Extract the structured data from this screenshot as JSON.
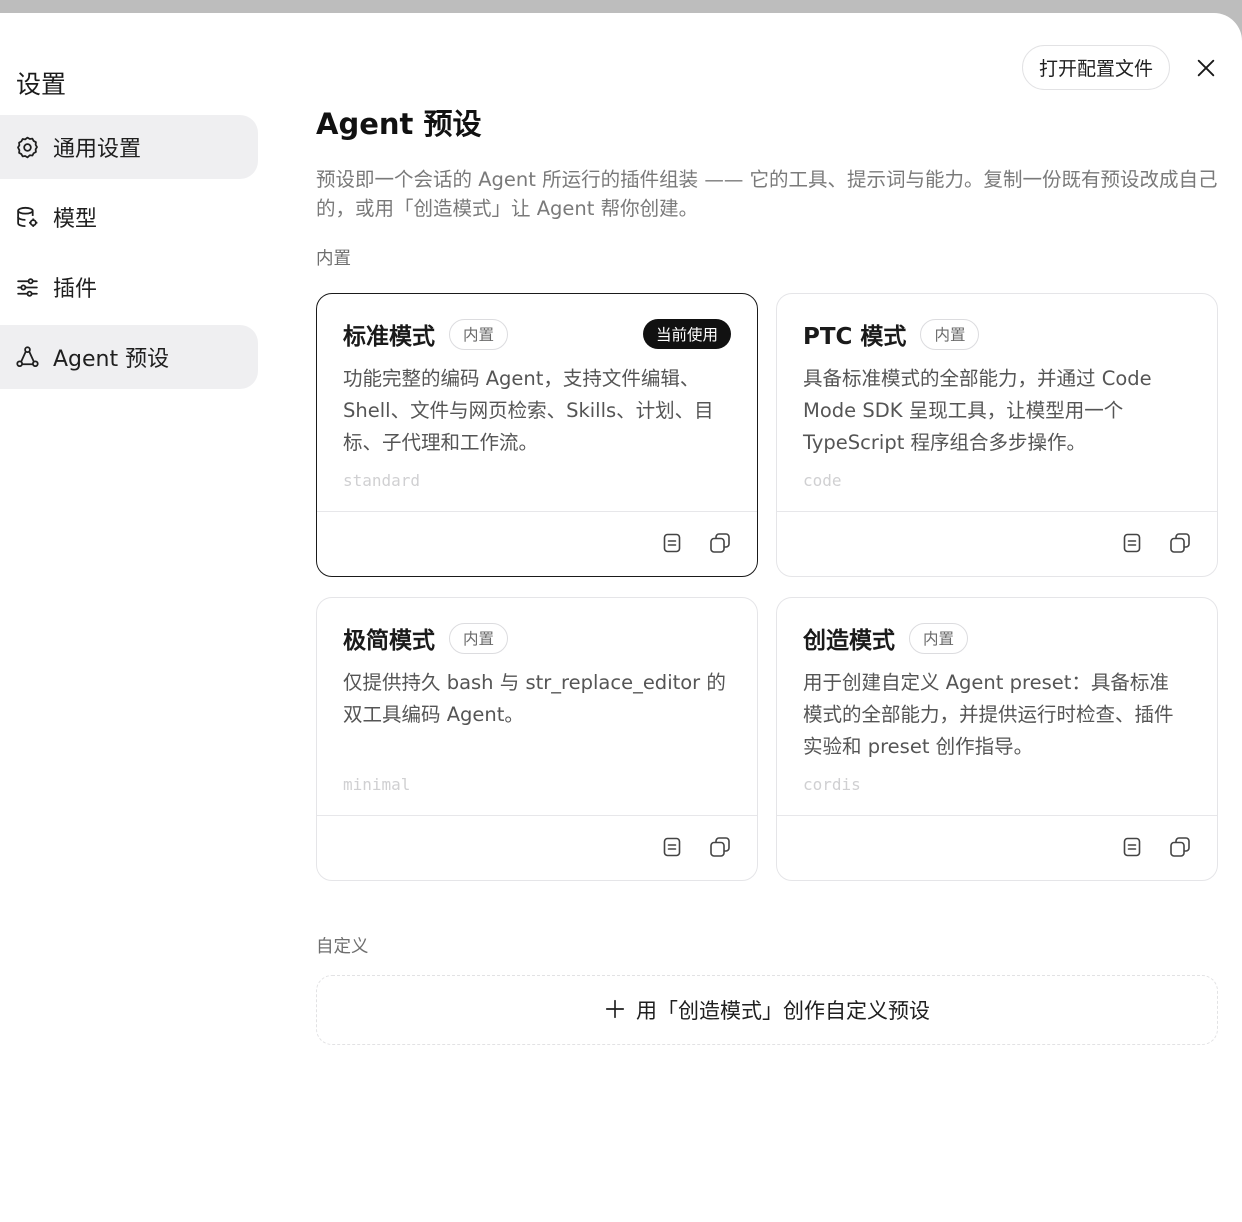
{
  "window": {
    "title": "设置"
  },
  "sidebar": {
    "items": [
      {
        "label": "通用设置",
        "icon": "gear-icon",
        "active": true
      },
      {
        "label": "模型",
        "icon": "database-icon",
        "active": false
      },
      {
        "label": "插件",
        "icon": "sliders-icon",
        "active": false
      },
      {
        "label": "Agent 预设",
        "icon": "nodes-icon",
        "active": true
      }
    ]
  },
  "header": {
    "open_config_label": "打开配置文件",
    "close_icon": "close-icon"
  },
  "main": {
    "title": "Agent 预设",
    "description": "预设即一个会话的 Agent 所运行的插件组装 —— 它的工具、提示词与能力。复制一份既有预设改成自己的，或用「创造模式」让 Agent 帮你创建。",
    "builtin_label": "内置",
    "custom_label": "自定义",
    "create_button_label": "用「创造模式」创作自定义预设",
    "presets": [
      {
        "name": "标准模式",
        "badge": "内置",
        "current": "当前使用",
        "description": "功能完整的编码 Agent，支持文件编辑、Shell、文件与网页检索、Skills、计划、目标、子代理和工作流。",
        "slug": "standard"
      },
      {
        "name": "PTC 模式",
        "badge": "内置",
        "description": "具备标准模式的全部能力，并通过 Code Mode SDK 呈现工具，让模型用一个 TypeScript 程序组合多步操作。",
        "slug": "code"
      },
      {
        "name": "极简模式",
        "badge": "内置",
        "description": "仅提供持久 bash 与 str_replace_editor 的双工具编码 Agent。",
        "slug": "minimal"
      },
      {
        "name": "创造模式",
        "badge": "内置",
        "description": "用于创建自定义 Agent preset：具备标准模式的全部能力，并提供运行时检查、插件实验和 preset 创作指导。",
        "slug": "cordis"
      }
    ]
  },
  "colors": {
    "accent": "#111111",
    "active_bg": "#efeff1",
    "muted_text": "#7a7a7a"
  }
}
